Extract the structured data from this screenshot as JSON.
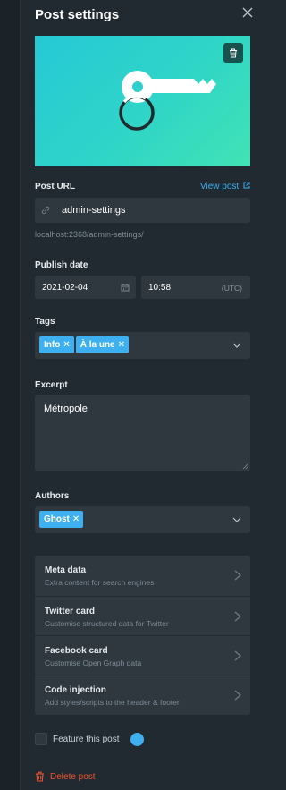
{
  "panel": {
    "title": "Post settings"
  },
  "post_url": {
    "label": "Post URL",
    "view_link": "View post",
    "value": "admin-settings",
    "hint": "localhost:2368/admin-settings/"
  },
  "publish_date": {
    "label": "Publish date",
    "date": "2021-02-04",
    "time": "10:58",
    "timezone": "(UTC)"
  },
  "tags": {
    "label": "Tags",
    "items": [
      "Info",
      "À la une"
    ]
  },
  "excerpt": {
    "label": "Excerpt",
    "value": "Métropole"
  },
  "authors": {
    "label": "Authors",
    "items": [
      "Ghost"
    ]
  },
  "menu": [
    {
      "title": "Meta data",
      "desc": "Extra content for search engines"
    },
    {
      "title": "Twitter card",
      "desc": "Customise structured data for Twitter"
    },
    {
      "title": "Facebook card",
      "desc": "Customise Open Graph data"
    },
    {
      "title": "Code injection",
      "desc": "Add styles/scripts to the header & footer"
    }
  ],
  "feature": {
    "label": "Feature this post"
  },
  "delete": {
    "label": "Delete post"
  },
  "colors": {
    "accent": "#3eb0ef",
    "danger": "#f05230",
    "panel_bg": "#222a31",
    "input_bg": "#2f383f"
  }
}
